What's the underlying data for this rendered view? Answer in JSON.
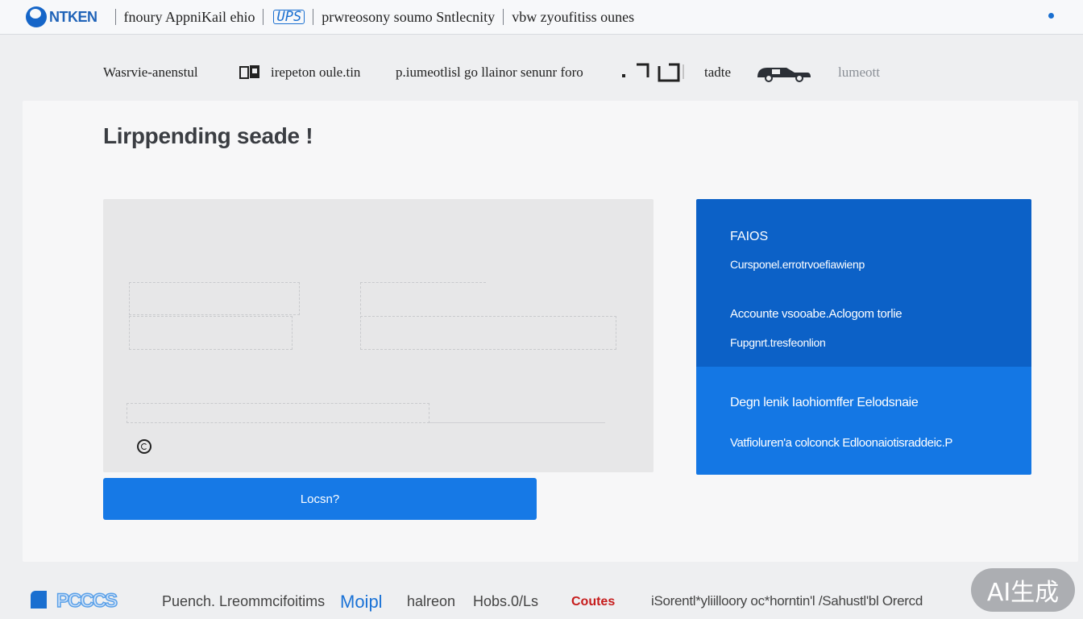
{
  "brand": {
    "name": "NTKEN",
    "icon": "brand-logo-icon"
  },
  "topbar": {
    "links": [
      "fnoury AppniKail ehio",
      "prwreosony soumo Sntlecnity",
      "vbw zyoufitiss ounes"
    ],
    "mark": "UPS",
    "accent": "#1a6fd0"
  },
  "subnav": {
    "items": [
      "Wasrvie-anenstul",
      "irepeton oule.tin",
      "p.iumeotlisl go llainor senunr foro",
      "tadte",
      "lumeott"
    ]
  },
  "main": {
    "title": "Lirppending seade !",
    "login_button": "Locsn?"
  },
  "faq": {
    "title": "FAIOS",
    "subtitle": "Cursponel.errotrvoefiawienp",
    "lines": [
      "Accounte vsooabe.Aclogom torlie",
      "Fupgnrt.tresfeonlion"
    ],
    "bottom_lines": [
      "Degn lenik Iaohiomffer Eelodsnaie",
      "Vatfioluren'a colconck Edloonaiotisraddeic.P"
    ],
    "colors": {
      "top": "#0c61c7",
      "bottom": "#1477e4"
    }
  },
  "footer": {
    "logo_text": "PCCCS",
    "items": [
      "Puench. Lreommcifoitims",
      "Moipl",
      "halreon",
      "Hobs.0/Ls",
      "Coutes",
      "iSorentl*yliilloory oc*horntin'l /Sahustl'bl Orercd"
    ]
  },
  "watermark": "AI生成"
}
